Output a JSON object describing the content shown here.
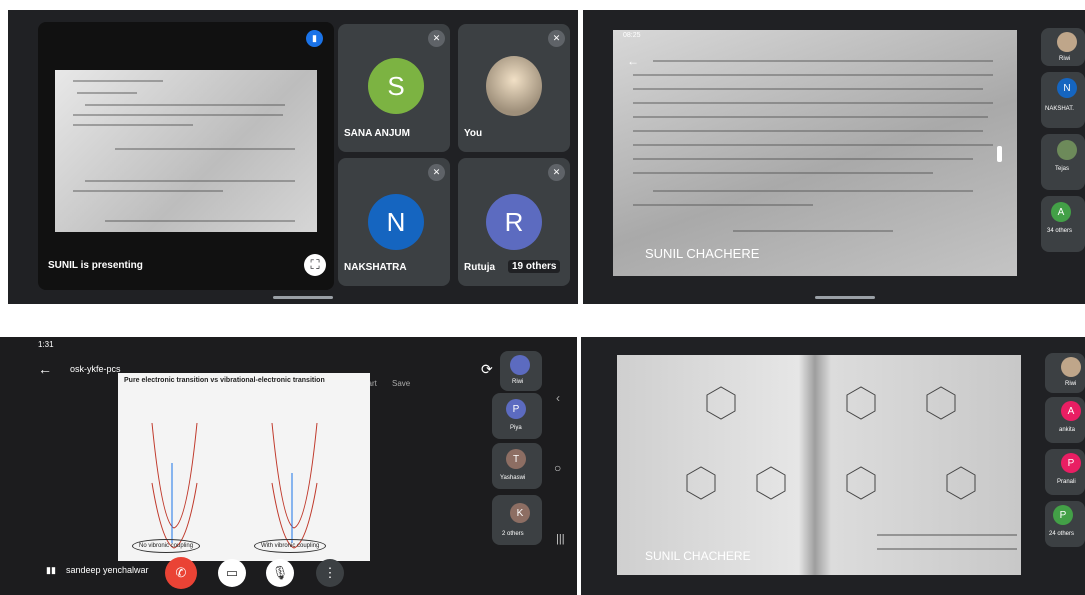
{
  "p1": {
    "presenter": "SUNIL is presenting",
    "tiles": [
      {
        "initial": "S",
        "name": "SANA ANJUM",
        "color": "#7cb342"
      },
      {
        "name": "You"
      },
      {
        "initial": "N",
        "name": "NAKSHATRA",
        "color": "#1565c0"
      },
      {
        "initial": "R",
        "name": "Rutuja",
        "color": "#5c6bc0",
        "others": "19 others"
      }
    ]
  },
  "p2": {
    "status_time": "08:25",
    "presenter": "SUNIL CHACHERE",
    "sidebar": [
      {
        "label": "Riwi"
      },
      {
        "initial": "N",
        "label": "NAKSHAT.",
        "color": "#1565c0"
      },
      {
        "label": "Tejas"
      },
      {
        "initial": "A",
        "label": "34 others",
        "color": "#43a047"
      }
    ]
  },
  "p3": {
    "status_time": "1:31",
    "title": "osk-ykfe-pcs",
    "actions": [
      "Start",
      "Save"
    ],
    "slide_title": "Pure electronic transition vs vibrational-electronic transition",
    "left_caption": "No vibronic coupling",
    "right_caption": "With vibronic coupling",
    "speaker": "sandeep yenchalwar",
    "sidebar": [
      {
        "label": "Riwi"
      },
      {
        "initial": "P",
        "label": "Piya",
        "color": "#5c6bc0"
      },
      {
        "initial": "T",
        "label": "Yashaswi",
        "color": "#8d6e63"
      },
      {
        "initial": "K",
        "label": "2 others",
        "color": "#8d6e63"
      }
    ]
  },
  "p4": {
    "presenter": "SUNIL CHACHERE",
    "sidebar": [
      {
        "label": "Riwi"
      },
      {
        "initial": "A",
        "label": "ankita",
        "color": "#e91e63"
      },
      {
        "initial": "P",
        "label": "Pranali",
        "color": "#e91e63"
      },
      {
        "initial": "P",
        "label": "24 others",
        "color": "#43a047"
      }
    ]
  }
}
